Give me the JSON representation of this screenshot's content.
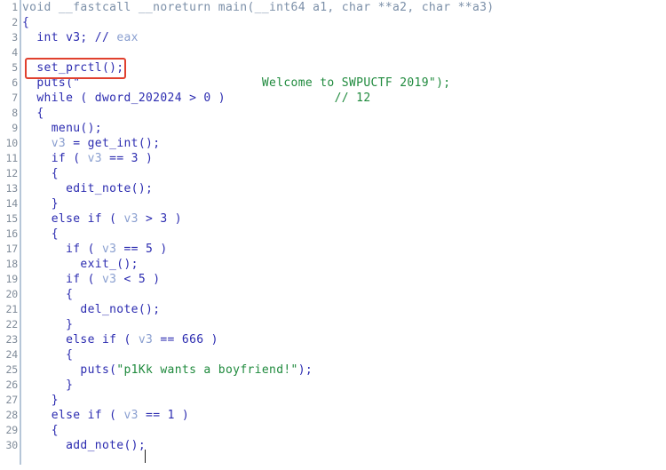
{
  "editor": {
    "name": "decompiler-pseudocode-view",
    "background_color": "#ffffff",
    "gutter_color": "#808c9a",
    "gutter_rule_color": "#b6c6d8",
    "keyword_color": "#2b2bb0",
    "variable_color": "#8a9fd0",
    "string_color": "#1f8a3d",
    "comment_color": "#1f8a3d",
    "declaration_color": "#7b8fa8",
    "annotation_color": "#e0402e",
    "first_line": 1,
    "last_line": 30,
    "line_height": 17
  },
  "annotation": {
    "kind": "red-rectangle-highlight",
    "target_line": 5,
    "target_text": "set_prctl();"
  },
  "line_numbers": [
    "1",
    "2",
    "3",
    "4",
    "5",
    "6",
    "7",
    "8",
    "9",
    "10",
    "11",
    "12",
    "13",
    "14",
    "15",
    "16",
    "17",
    "18",
    "19",
    "20",
    "21",
    "22",
    "23",
    "24",
    "25",
    "26",
    "27",
    "28",
    "29",
    "30"
  ],
  "lines": {
    "l1": {
      "num": "1",
      "text": "void __fastcall __noreturn main(__int64 a1, char **a2, char **a3)"
    },
    "l2": {
      "num": "2",
      "text": "{"
    },
    "l3": {
      "num": "3",
      "indent": "  ",
      "code": "int v3; // ",
      "tail": "eax"
    },
    "l4": {
      "num": "4",
      "text": ""
    },
    "l5": {
      "num": "5",
      "indent": "  ",
      "code": "set_prctl();"
    },
    "l6": {
      "num": "6",
      "indent": "  ",
      "code": "puts(\"",
      "gap": "                         ",
      "str": "Welcome to SWPUCTF 2019\");"
    },
    "l7": {
      "num": "7",
      "indent": "  ",
      "code": "while ( dword_202024 > 0 )",
      "gap": "               ",
      "cmt": "// 12"
    },
    "l8": {
      "num": "8",
      "indent": "  ",
      "code": "{"
    },
    "l9": {
      "num": "9",
      "indent": "    ",
      "code": "menu();"
    },
    "l10": {
      "num": "10",
      "indent": "    ",
      "pre": "",
      "var": "v3",
      "post": " = get_int();"
    },
    "l11": {
      "num": "11",
      "indent": "    ",
      "pre": "if ( ",
      "var": "v3",
      "post": " == 3 )"
    },
    "l12": {
      "num": "12",
      "indent": "    ",
      "code": "{"
    },
    "l13": {
      "num": "13",
      "indent": "      ",
      "code": "edit_note();"
    },
    "l14": {
      "num": "14",
      "indent": "    ",
      "code": "}"
    },
    "l15": {
      "num": "15",
      "indent": "    ",
      "pre": "else if ( ",
      "var": "v3",
      "post": " > 3 )"
    },
    "l16": {
      "num": "16",
      "indent": "    ",
      "code": "{"
    },
    "l17": {
      "num": "17",
      "indent": "      ",
      "pre": "if ( ",
      "var": "v3",
      "post": " == 5 )"
    },
    "l18": {
      "num": "18",
      "indent": "        ",
      "code": "exit_();"
    },
    "l19": {
      "num": "19",
      "indent": "      ",
      "pre": "if ( ",
      "var": "v3",
      "post": " < 5 )"
    },
    "l20": {
      "num": "20",
      "indent": "      ",
      "code": "{"
    },
    "l21": {
      "num": "21",
      "indent": "        ",
      "code": "del_note();"
    },
    "l22": {
      "num": "22",
      "indent": "      ",
      "code": "}"
    },
    "l23": {
      "num": "23",
      "indent": "      ",
      "pre": "else if ( ",
      "var": "v3",
      "post": " == 666 )"
    },
    "l24": {
      "num": "24",
      "indent": "      ",
      "code": "{"
    },
    "l25": {
      "num": "25",
      "indent": "        ",
      "pre": "puts(",
      "str": "\"p1Kk wants a boyfriend!\"",
      "post": ");"
    },
    "l26": {
      "num": "26",
      "indent": "      ",
      "code": "}"
    },
    "l27": {
      "num": "27",
      "indent": "    ",
      "code": "}"
    },
    "l28": {
      "num": "28",
      "indent": "    ",
      "pre": "else if ( ",
      "var": "v3",
      "post": " == 1 )"
    },
    "l29": {
      "num": "29",
      "indent": "    ",
      "code": "{"
    },
    "l30": {
      "num": "30",
      "indent": "      ",
      "code": "add_note();"
    }
  }
}
